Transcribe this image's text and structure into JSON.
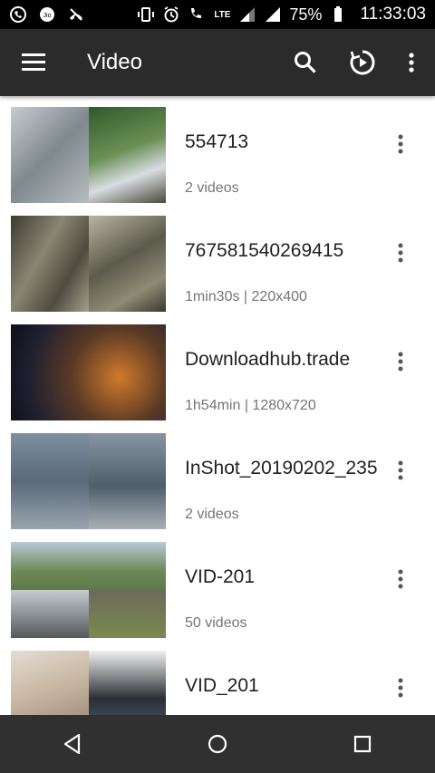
{
  "status_bar": {
    "icons_left": [
      "whatsapp-icon",
      "jio-icon",
      "missed-call-icon"
    ],
    "icons_right": [
      "vibrate-icon",
      "alarm-icon",
      "wifi-calling-icon",
      "lte-signal-icon",
      "signal-icon",
      "signal-icon",
      "battery-icon"
    ],
    "lte_label": "LTE",
    "battery": "75%",
    "time": "11:33:03"
  },
  "app_bar": {
    "title": "Video",
    "icons": [
      "menu-icon",
      "search-icon",
      "history-icon",
      "more-vert-icon"
    ]
  },
  "folders": [
    {
      "name": "554713",
      "info": "2 videos",
      "thumb_colors": [
        "#9aa3a8",
        "#3f6b3a"
      ]
    },
    {
      "name": "767581540269415",
      "info": "1min30s  |  220x400",
      "thumb_colors": [
        "#6e6a5e",
        "#5b5a4c"
      ]
    },
    {
      "name": "Downloadhub.trade",
      "info": "1h54min  |  1280x720",
      "thumb_colors": [
        "#2a2a3a",
        "#b06a2a"
      ]
    },
    {
      "name": "InShot_20190202_235",
      "info": "2 videos",
      "thumb_colors": [
        "#5d6b7a",
        "#4f5e6b"
      ]
    },
    {
      "name": "VID-201",
      "info": "50 videos",
      "thumb_colors": [
        "#6f8a5a",
        "#6b6a5c"
      ]
    },
    {
      "name": "VID_201",
      "info": "",
      "thumb_colors": [
        "#c9b9a5",
        "#2b2f35"
      ]
    }
  ],
  "nav_bar": {
    "icons": [
      "back-icon",
      "home-icon",
      "recents-icon"
    ]
  },
  "colors": {
    "app_bar": "#2b2b2b",
    "status_bar": "#000000",
    "nav_bar": "#303030",
    "title_text": "#212121",
    "secondary_text": "#757575"
  }
}
